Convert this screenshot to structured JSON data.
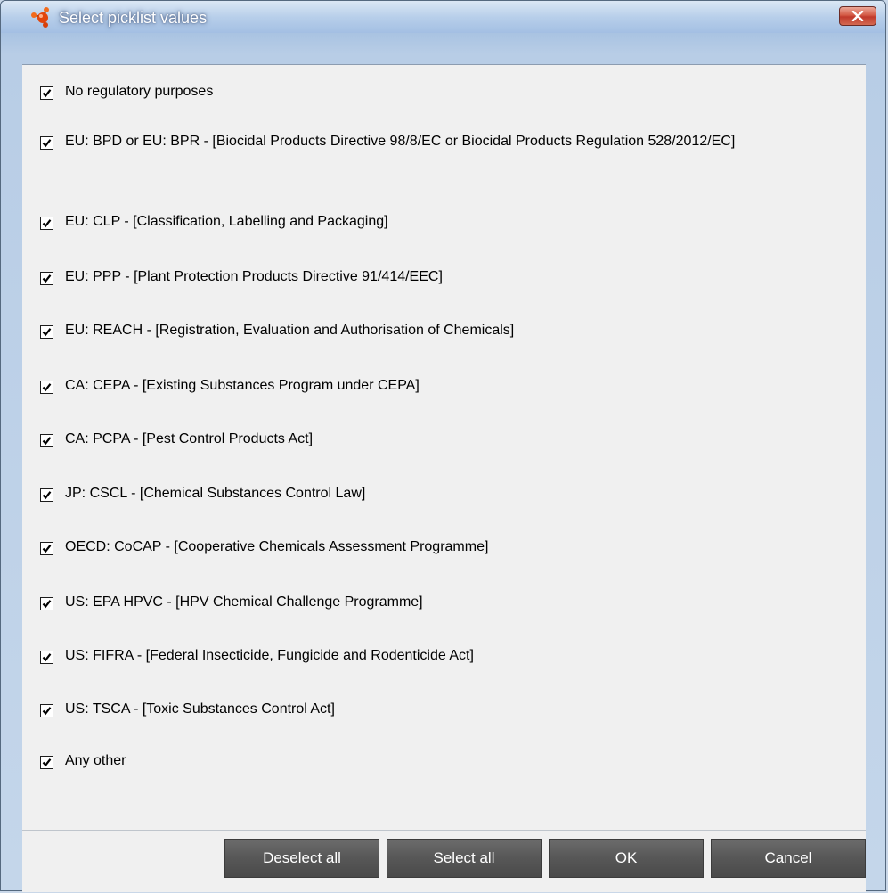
{
  "dialog": {
    "title": "Select picklist values",
    "icon": "molecule-icon",
    "close_icon": "close-icon"
  },
  "options": [
    {
      "label": "No regulatory purposes",
      "checked": true
    },
    {
      "label": "EU: BPD or EU: BPR - [Biocidal Products Directive 98/8/EC or Biocidal Products Regulation 528/2012/EC]",
      "checked": true
    },
    {
      "label": "EU: CLP - [Classification, Labelling and Packaging]",
      "checked": true
    },
    {
      "label": "EU: PPP - [Plant Protection Products Directive 91/414/EEC]",
      "checked": true
    },
    {
      "label": "EU: REACH - [Registration, Evaluation and Authorisation of Chemicals]",
      "checked": true
    },
    {
      "label": "CA: CEPA - [Existing Substances Program under CEPA]",
      "checked": true
    },
    {
      "label": "CA: PCPA - [Pest Control Products Act]",
      "checked": true
    },
    {
      "label": "JP: CSCL - [Chemical Substances Control Law]",
      "checked": true
    },
    {
      "label": "OECD: CoCAP - [Cooperative Chemicals Assessment Programme]",
      "checked": true
    },
    {
      "label": "US: EPA HPVC - [HPV Chemical Challenge Programme]",
      "checked": true
    },
    {
      "label": "US: FIFRA - [Federal Insecticide, Fungicide and Rodenticide Act]",
      "checked": true
    },
    {
      "label": "US: TSCA - [Toxic Substances Control Act]",
      "checked": true
    },
    {
      "label": "Any other",
      "checked": true
    }
  ],
  "buttons": {
    "deselect_all": "Deselect all",
    "select_all": "Select all",
    "ok": "OK",
    "cancel": "Cancel"
  },
  "colors": {
    "title_bar": "#a9c3e2",
    "panel": "#f0f0f0",
    "button": "#575757",
    "close_button": "#c0392b"
  }
}
